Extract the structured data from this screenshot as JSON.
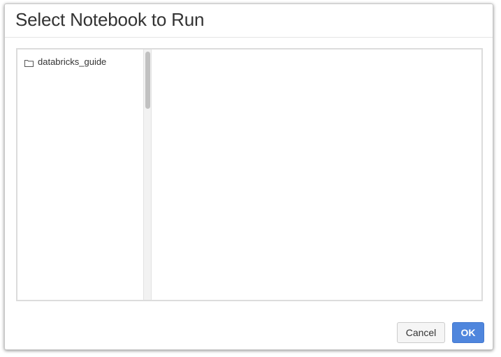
{
  "dialog": {
    "title": "Select Notebook to Run",
    "cancel_label": "Cancel",
    "ok_label": "OK"
  },
  "file_tree": {
    "items": [
      {
        "label": "databricks_guide",
        "icon": "folder-icon"
      }
    ]
  },
  "colors": {
    "primary_button": "#4f86dd",
    "secondary_button": "#f5f5f5",
    "border": "#dcdcdc"
  }
}
